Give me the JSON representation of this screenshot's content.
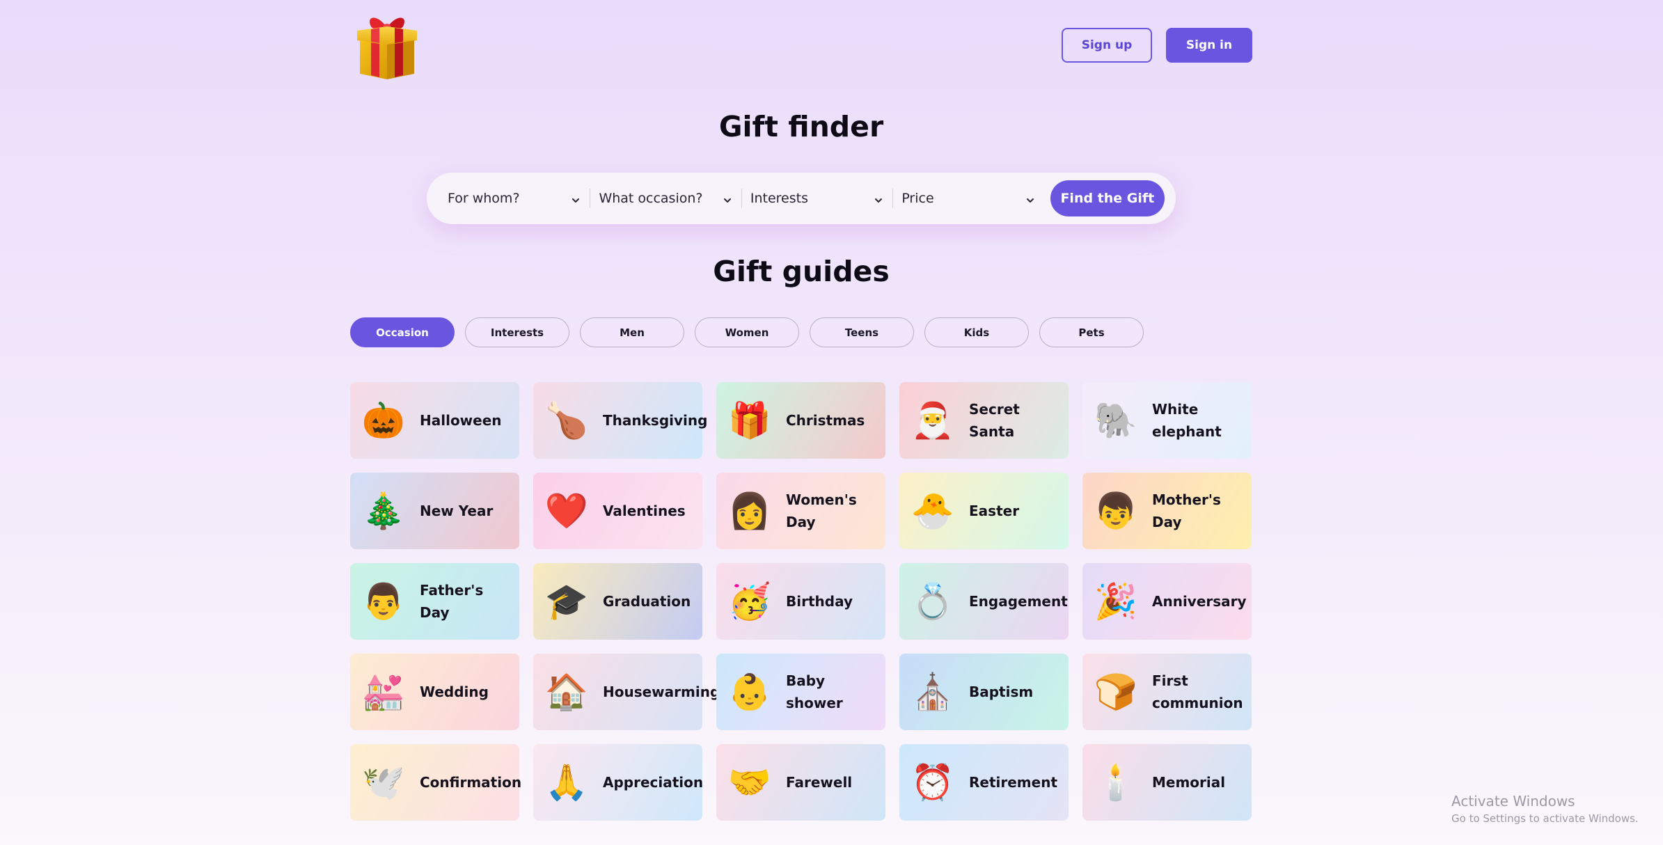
{
  "header": {
    "logo_icon": "gift-icon",
    "signup_label": "Sign up",
    "signin_label": "Sign in"
  },
  "finder": {
    "title": "Gift finder",
    "selects": [
      {
        "label": "For whom?"
      },
      {
        "label": "What occasion?"
      },
      {
        "label": "Interests"
      },
      {
        "label": "Price"
      }
    ],
    "button_label": "Find the Gift"
  },
  "guides": {
    "title": "Gift guides",
    "tabs": [
      "Occasion",
      "Interests",
      "Men",
      "Women",
      "Teens",
      "Kids",
      "Pets"
    ],
    "active_tab": "Occasion",
    "cards": [
      {
        "label": "Halloween",
        "emoji": "🎃",
        "icon": "pumpkin-icon",
        "bg": "linear-gradient(120deg,#f8dce6,#d6e4f6)"
      },
      {
        "label": "Thanksgiving",
        "emoji": "🍗",
        "icon": "poultry-leg-icon",
        "bg": "linear-gradient(120deg,#f8dce6,#cde8fb)"
      },
      {
        "label": "Christmas",
        "emoji": "🎁",
        "icon": "gift-icon",
        "bg": "linear-gradient(120deg,#cdf4e2,#f4c9cb)"
      },
      {
        "label": "Secret Santa",
        "emoji": "🎅",
        "icon": "santa-icon",
        "bg": "linear-gradient(120deg,#fbcfd6,#dcece6)"
      },
      {
        "label": "White elephant",
        "emoji": "🐘",
        "icon": "elephant-icon",
        "bg": "linear-gradient(120deg,#f6ecfb,#e2f0fb)"
      },
      {
        "label": "New Year",
        "emoji": "🎄",
        "icon": "christmas-tree-icon",
        "bg": "linear-gradient(120deg,#d2dff6,#f1c8cf)"
      },
      {
        "label": "Valentines",
        "emoji": "❤️",
        "icon": "heart-icon",
        "bg": "linear-gradient(120deg,#fbd0ea,#fbe3ef)"
      },
      {
        "label": "Women's Day",
        "emoji": "👩",
        "icon": "woman-icon",
        "bg": "linear-gradient(120deg,#fbd9ea,#fde6d2)"
      },
      {
        "label": "Easter",
        "emoji": "🐣",
        "icon": "hatching-chick-icon",
        "bg": "linear-gradient(120deg,#fdf0c7,#d4f8ea)"
      },
      {
        "label": "Mother's Day",
        "emoji": "👦",
        "icon": "person-icon",
        "bg": "linear-gradient(120deg,#fdd6c8,#fdf0ad)"
      },
      {
        "label": "Father's Day",
        "emoji": "👨",
        "icon": "man-icon",
        "bg": "linear-gradient(120deg,#c9f4e4,#c8e6f7)"
      },
      {
        "label": "Graduation",
        "emoji": "🎓",
        "icon": "graduation-cap-icon",
        "bg": "linear-gradient(120deg,#f9ebbd,#c3cbf3)"
      },
      {
        "label": "Birthday",
        "emoji": "🥳",
        "icon": "party-face-icon",
        "bg": "linear-gradient(120deg,#fbdcea,#d5e6f7)"
      },
      {
        "label": "Engagement",
        "emoji": "💍",
        "icon": "ring-icon",
        "bg": "linear-gradient(120deg,#cdf2e5,#ecd6f3)"
      },
      {
        "label": "Anniversary",
        "emoji": "🎉",
        "icon": "party-popper-icon",
        "bg": "linear-gradient(120deg,#e5dcf9,#fbdcec)"
      },
      {
        "label": "Wedding",
        "emoji": "💒",
        "icon": "wedding-chapel-icon",
        "bg": "linear-gradient(120deg,#fdecd2,#fbd5de)"
      },
      {
        "label": "Housewarming",
        "emoji": "🏠",
        "icon": "house-icon",
        "bg": "linear-gradient(120deg,#fbdfe6,#d7e3f6)"
      },
      {
        "label": "Baby shower",
        "emoji": "👶",
        "icon": "baby-icon",
        "bg": "linear-gradient(120deg,#cde8fb,#f1dcfa)"
      },
      {
        "label": "Baptism",
        "emoji": "⛪",
        "icon": "church-icon",
        "bg": "linear-gradient(120deg,#c7dcf9,#c9f4e6)"
      },
      {
        "label": "First communion",
        "emoji": "🍞",
        "icon": "bread-icon",
        "bg": "linear-gradient(120deg,#fbdfe8,#cfe6f8)"
      },
      {
        "label": "Confirmation",
        "emoji": "🕊️",
        "icon": "dove-icon",
        "bg": "linear-gradient(120deg,#fdf0cf,#fbdfe6)"
      },
      {
        "label": "Appreciation",
        "emoji": "🙏",
        "icon": "folded-hands-icon",
        "bg": "linear-gradient(120deg,#fbe7ef,#cfe8fb)"
      },
      {
        "label": "Farewell",
        "emoji": "🤝",
        "icon": "handshake-icon",
        "bg": "linear-gradient(120deg,#fbdfe8,#cfe6f8)"
      },
      {
        "label": "Retirement",
        "emoji": "⏰",
        "icon": "alarm-clock-icon",
        "bg": "linear-gradient(120deg,#cde8fb,#e4e4f6)"
      },
      {
        "label": "Memorial",
        "emoji": "🕯️",
        "icon": "candle-icon",
        "bg": "linear-gradient(120deg,#fbdde8,#cfe6f8)"
      }
    ]
  },
  "watermark": {
    "line1": "Activate Windows",
    "line2": "Go to Settings to activate Windows."
  },
  "colors": {
    "accent": "#6a55e0",
    "background_top": "#e9dcfb",
    "background_bottom": "#fbf7fc"
  }
}
